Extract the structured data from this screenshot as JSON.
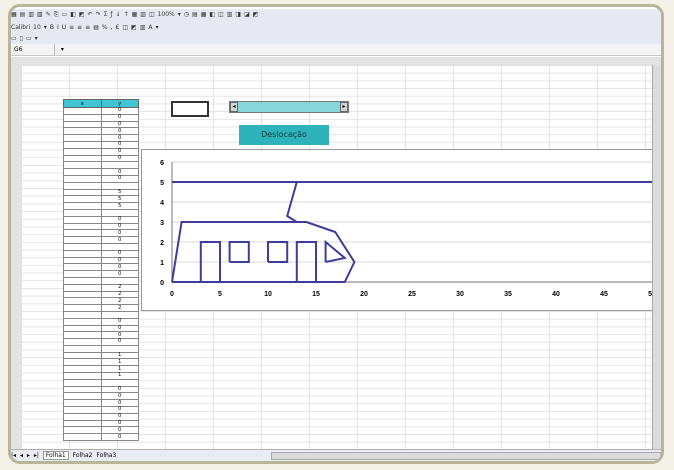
{
  "toolbar": {
    "row1": [
      "▦",
      "▤",
      "▥",
      "▧",
      "✎",
      "⎘",
      "▭",
      "◧",
      "◩",
      "↶",
      "↷",
      "Σ",
      "ƒ",
      "↓",
      "↑",
      "▦",
      "▥",
      "◫",
      "100%",
      "▾",
      "◷",
      "▤",
      "▦",
      "◧",
      "◫",
      "▥",
      "◨",
      "◪",
      "◩"
    ],
    "row2": [
      "Calibri",
      "10",
      "▾",
      "B",
      "I",
      "U",
      "≡",
      "≡",
      "≡",
      "▤",
      "%",
      "‚",
      "€",
      "◫",
      "◩",
      "▥",
      "A",
      "▾"
    ],
    "row3": [
      "▭",
      "▯",
      "▭",
      "▾"
    ]
  },
  "name_box": "G6",
  "table": {
    "headers": [
      "x",
      "y"
    ],
    "rows": [
      [
        "",
        "0"
      ],
      [
        "",
        "0"
      ],
      [
        "",
        "0"
      ],
      [
        "",
        "0"
      ],
      [
        "",
        "0"
      ],
      [
        "",
        "0"
      ],
      [
        "",
        "0"
      ],
      [
        "",
        "0"
      ],
      [
        "",
        ""
      ],
      [
        "",
        "0"
      ],
      [
        "",
        "0"
      ],
      [
        "",
        ""
      ],
      [
        "",
        "5"
      ],
      [
        "",
        "5"
      ],
      [
        "",
        "5"
      ],
      [
        "",
        ""
      ],
      [
        "",
        "0"
      ],
      [
        "",
        "0"
      ],
      [
        "",
        "0"
      ],
      [
        "",
        "0"
      ],
      [
        "",
        ""
      ],
      [
        "",
        "0"
      ],
      [
        "",
        "0"
      ],
      [
        "",
        "0"
      ],
      [
        "",
        "0"
      ],
      [
        "",
        ""
      ],
      [
        "",
        "2"
      ],
      [
        "",
        "2"
      ],
      [
        "",
        "2"
      ],
      [
        "",
        "2"
      ],
      [
        "",
        ""
      ],
      [
        "",
        "0"
      ],
      [
        "",
        "0"
      ],
      [
        "",
        "0"
      ],
      [
        "",
        "0"
      ],
      [
        "",
        ""
      ],
      [
        "",
        "1"
      ],
      [
        "",
        "1"
      ],
      [
        "",
        "1"
      ],
      [
        "",
        "1"
      ],
      [
        "",
        ""
      ],
      [
        "",
        "0"
      ],
      [
        "",
        "0"
      ],
      [
        "",
        "0"
      ],
      [
        "",
        "0"
      ],
      [
        "",
        "0"
      ],
      [
        "",
        "0"
      ],
      [
        "",
        "0"
      ],
      [
        "",
        "0"
      ]
    ]
  },
  "button_label": "Deslocação",
  "sheet_tabs": [
    "Folha1",
    "Folha2",
    "Folha3"
  ],
  "colors": {
    "accent": "#2fb3bb",
    "series": "#3d3d9a"
  },
  "chart_data": {
    "type": "scatter",
    "xlim": [
      0,
      50
    ],
    "ylim": [
      0,
      6
    ],
    "xticks": [
      0,
      5,
      10,
      15,
      20,
      25,
      30,
      35,
      40,
      45,
      50
    ],
    "yticks": [
      0,
      1,
      2,
      3,
      4,
      5,
      6
    ],
    "grid": true,
    "series": [
      {
        "points": [
          [
            0,
            5
          ],
          [
            50,
            5
          ]
        ]
      },
      {
        "points": [
          [
            13,
            5
          ],
          [
            12,
            3.3
          ],
          [
            13,
            3
          ]
        ]
      },
      {
        "points": [
          [
            0,
            0
          ],
          [
            1,
            3
          ],
          [
            14,
            3
          ],
          [
            17,
            2.5
          ],
          [
            19,
            1
          ],
          [
            18,
            0
          ],
          [
            0,
            0
          ]
        ]
      },
      {
        "points": [
          [
            3,
            0
          ],
          [
            3,
            2
          ],
          [
            5,
            2
          ],
          [
            5,
            0
          ]
        ]
      },
      {
        "points": [
          [
            6,
            1
          ],
          [
            6,
            2
          ],
          [
            8,
            2
          ],
          [
            8,
            1
          ],
          [
            6,
            1
          ]
        ]
      },
      {
        "points": [
          [
            10,
            1
          ],
          [
            10,
            2
          ],
          [
            12,
            2
          ],
          [
            12,
            1
          ],
          [
            10,
            1
          ]
        ]
      },
      {
        "points": [
          [
            13,
            0
          ],
          [
            13,
            2
          ],
          [
            15,
            2
          ],
          [
            15,
            0
          ]
        ]
      },
      {
        "points": [
          [
            16,
            1
          ],
          [
            16,
            2
          ],
          [
            18,
            1.2
          ],
          [
            16,
            1
          ]
        ]
      }
    ]
  }
}
